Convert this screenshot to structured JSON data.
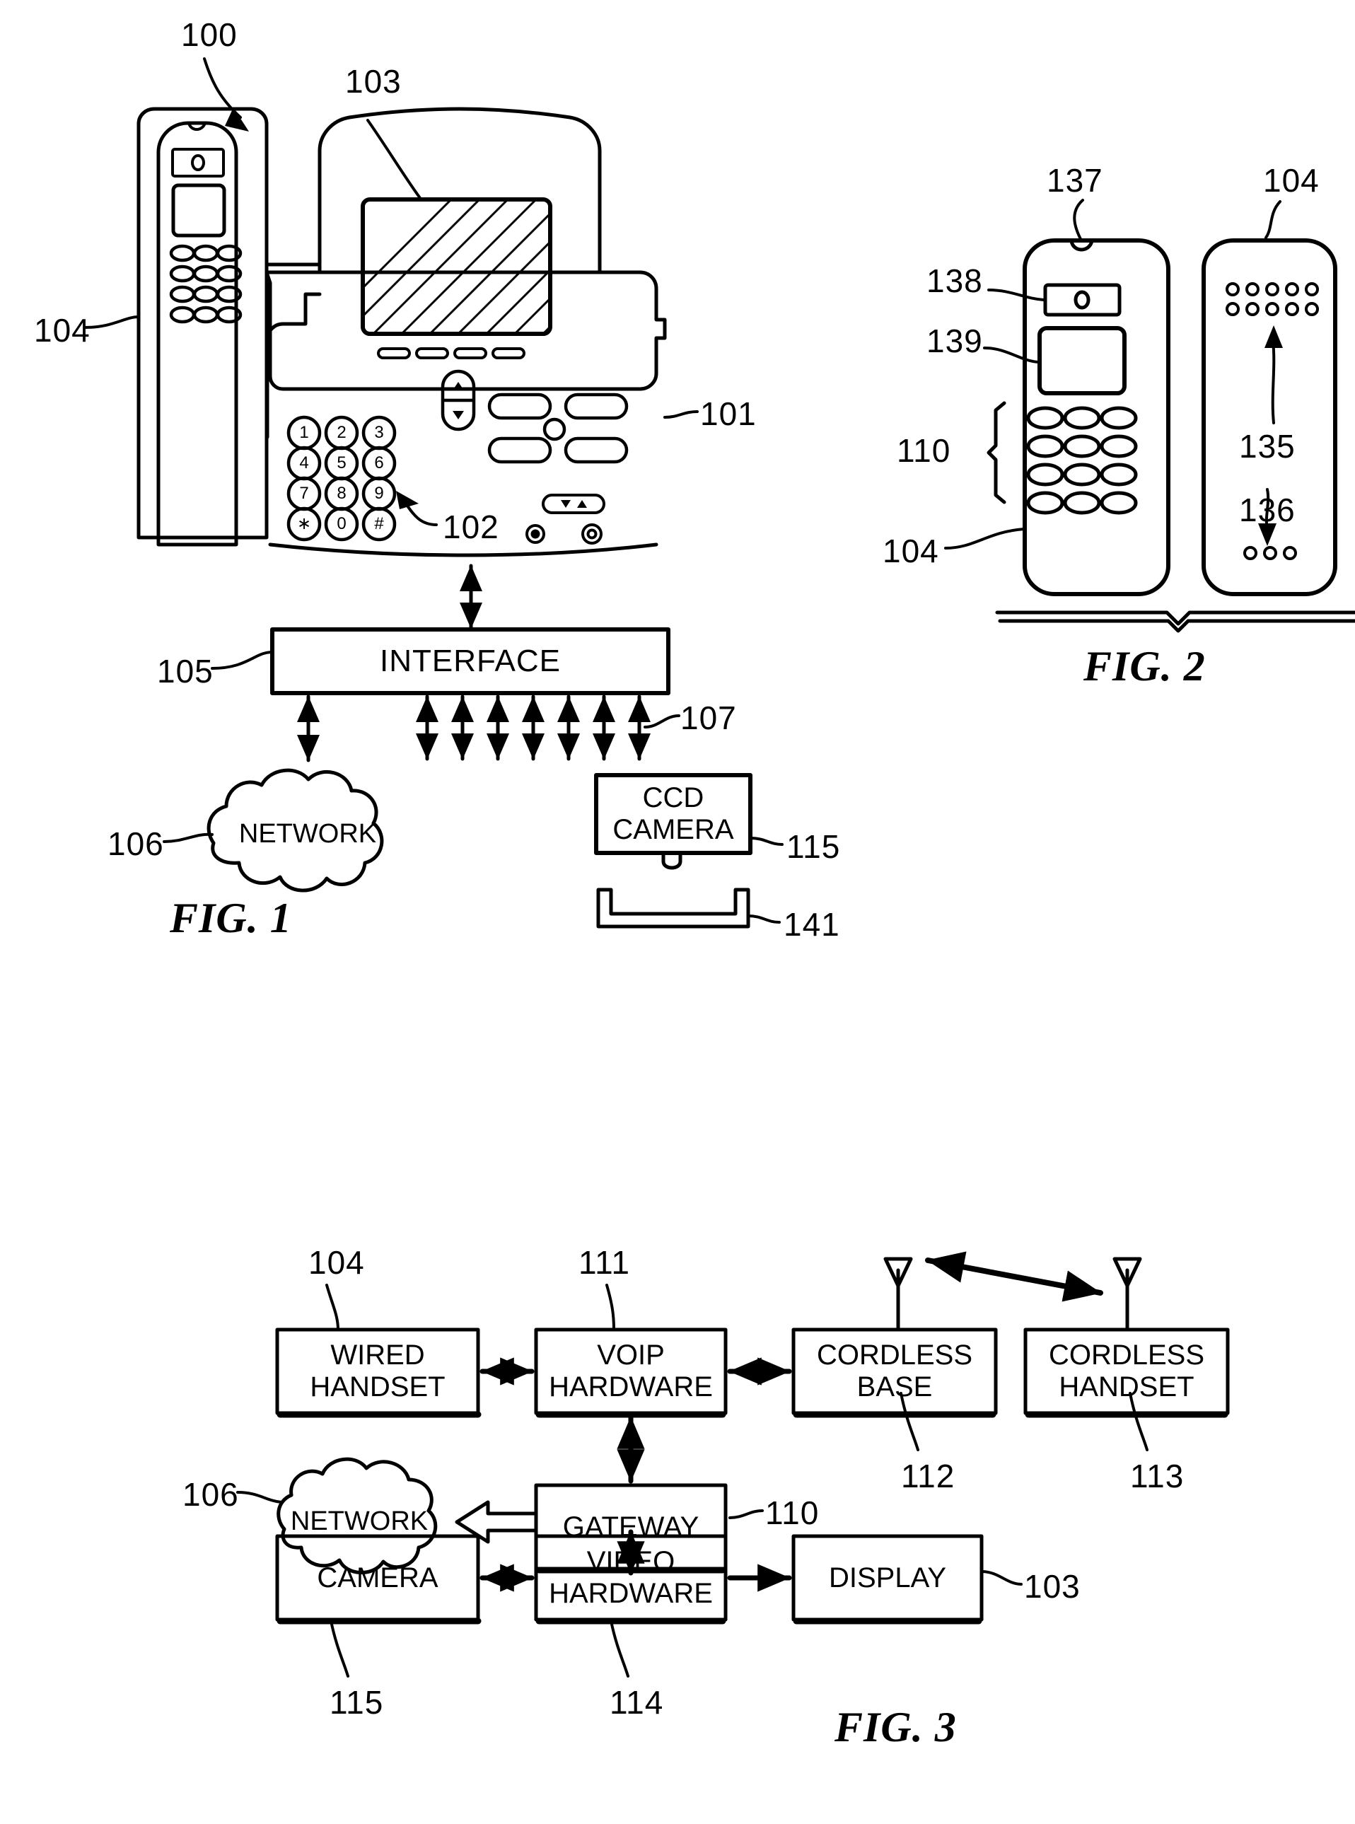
{
  "document": {
    "type": "patent-drawing",
    "figures": [
      "FIG. 1",
      "FIG. 2",
      "FIG. 3"
    ]
  },
  "fig1": {
    "label": "FIG. 1",
    "refs": {
      "system": "100",
      "display": "103",
      "handset": "104",
      "base": "101",
      "keypad": "102",
      "interface": "105",
      "network": "106",
      "bus": "107",
      "camera": "115",
      "cradle": "141"
    },
    "boxes": {
      "interface": "INTERFACE",
      "camera": "CCD\nCAMERA"
    },
    "cloud": "NETWORK",
    "keypad_keys": [
      "1",
      "2",
      "3",
      "4",
      "5",
      "6",
      "7",
      "8",
      "9",
      "∗",
      "0",
      "#"
    ]
  },
  "fig2": {
    "label": "FIG. 2",
    "refs": {
      "earpiece": "137",
      "speaker_grille": "138",
      "display": "139",
      "keypad_bracket": "110",
      "handset_front": "104",
      "handset_back": "104",
      "upper_holes": "135",
      "lower_holes": "136"
    }
  },
  "fig3": {
    "label": "FIG. 3",
    "blocks": [
      {
        "id": "wired-handset",
        "text": "WIRED\nHANDSET",
        "ref": "104"
      },
      {
        "id": "voip-hardware",
        "text": "VOIP\nHARDWARE",
        "ref": "111"
      },
      {
        "id": "cordless-base",
        "text": "CORDLESS\nBASE",
        "ref": "112"
      },
      {
        "id": "cordless-handset",
        "text": "CORDLESS\nHANDSET",
        "ref": "113"
      },
      {
        "id": "gateway",
        "text": "GATEWAY",
        "ref": "110"
      },
      {
        "id": "camera",
        "text": "CAMERA",
        "ref": "115"
      },
      {
        "id": "video-hardware",
        "text": "VIDEO\nHARDWARE",
        "ref": "114"
      },
      {
        "id": "display",
        "text": "DISPLAY",
        "ref": "103"
      }
    ],
    "cloud": {
      "text": "NETWORK",
      "ref": "106"
    }
  },
  "colors": {
    "ink": "#000000",
    "paper": "#ffffff"
  }
}
